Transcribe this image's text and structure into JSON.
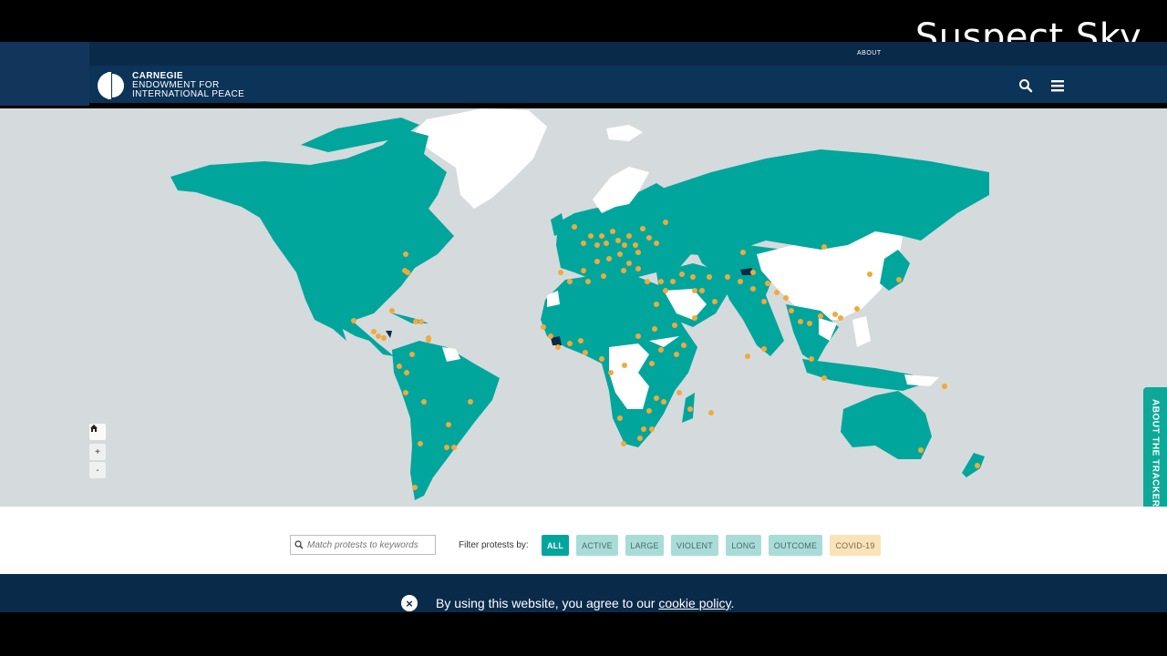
{
  "watermark": "Suspect Sky",
  "header": {
    "about_link": "ABOUT",
    "logo_line1": "CARNEGIE",
    "logo_line2": "ENDOWMENT FOR",
    "logo_line3": "INTERNATIONAL PEACE"
  },
  "icons": {
    "search": "search-icon",
    "menu": "hamburger-menu-icon",
    "home": "home-icon",
    "close": "close-icon"
  },
  "map": {
    "zoom_in": "+",
    "zoom_out": "-",
    "about_tab": "ABOUT THE TRACKER",
    "colors": {
      "ocean": "#d5dadd",
      "protest_country": "#00a69c",
      "no_protest_country": "#ffffff",
      "protest_marker": "#f2a93b",
      "highlight_country": "#0a2a4a"
    }
  },
  "filters": {
    "search_placeholder": "Match protests to keywords",
    "label": "Filter protests by:",
    "chips": [
      {
        "label": "ALL",
        "active": true
      },
      {
        "label": "ACTIVE"
      },
      {
        "label": "LARGE"
      },
      {
        "label": "VIOLENT"
      },
      {
        "label": "LONG"
      },
      {
        "label": "OUTCOME"
      },
      {
        "label": "COVID-19"
      }
    ]
  },
  "cookie": {
    "text_before": "By using this website, you agree to our ",
    "link_text": "cookie policy",
    "text_after": "."
  }
}
